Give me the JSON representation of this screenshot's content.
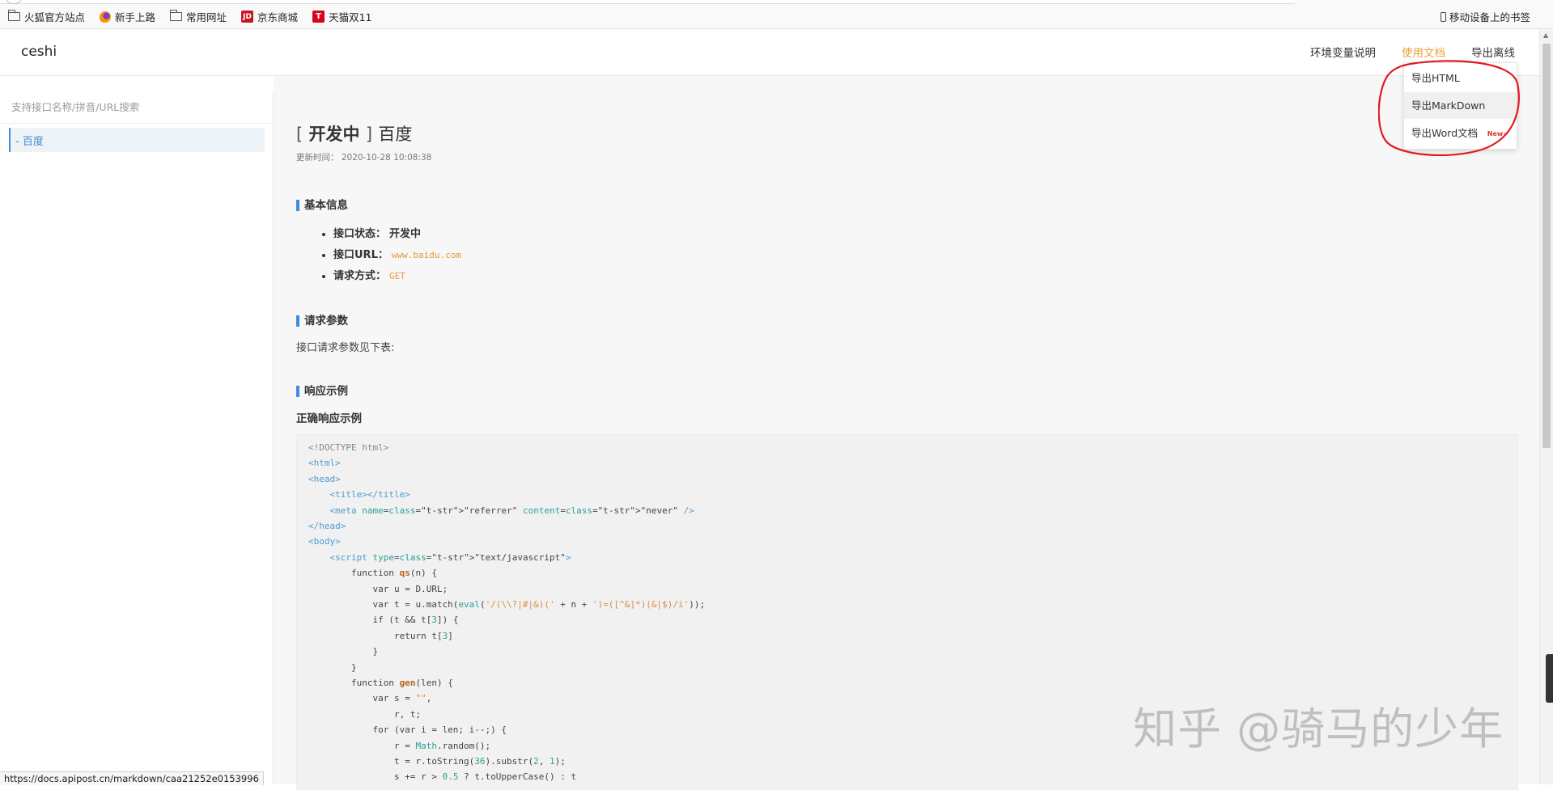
{
  "bookmarks": {
    "items": [
      {
        "label": "火狐官方站点",
        "icon": "folder-icon"
      },
      {
        "label": "新手上路",
        "icon": "firefox-icon"
      },
      {
        "label": "常用网址",
        "icon": "folder-icon"
      },
      {
        "label": "京东商城",
        "icon": "jd-icon",
        "icon_text": "JD"
      },
      {
        "label": "天猫双11",
        "icon": "tmall-icon",
        "icon_text": "T"
      }
    ],
    "mobile": "移动设备上的书签"
  },
  "header": {
    "logo": "ceshi",
    "nav": [
      "环境变量说明",
      "使用文档",
      "导出离线"
    ],
    "active_color": "#e8a33d"
  },
  "sidebar": {
    "search_placeholder": "支持接口名称/拼音/URL搜索",
    "items": [
      {
        "label": "- 百度"
      }
    ],
    "accent": "#3f8cd8"
  },
  "doc": {
    "status_bracket_open": "[",
    "status_word": "开发中",
    "status_bracket_close": "]",
    "name": "百度",
    "update_time": "更新时间：  2020-10-28 10:08:38",
    "sections": {
      "basic": "基本信息",
      "params": "请求参数",
      "response": "响应示例"
    },
    "info": [
      {
        "key": "接口状态：",
        "value": "开发中"
      },
      {
        "key": "接口URL：",
        "value": "www.baidu.com"
      },
      {
        "key": "请求方式：",
        "value": "GET"
      }
    ],
    "params_text": "接口请求参数见下表:",
    "response_sub": "正确响应示例"
  },
  "code_lines": [
    "<!DOCTYPE html>",
    "<html>",
    "<head>",
    "    <title></title>",
    "    <meta name=\"referrer\" content=\"never\" />",
    "</head>",
    "<body>",
    "    <script type=\"text/javascript\">",
    "        function qs(n) {",
    "            var u = D.URL;",
    "            var t = u.match(eval('/(\\\\?|#|&)(' + n + ')=([^&]*)(&|$)/i'));",
    "            if (t && t[3]) {",
    "                return t[3]",
    "            }",
    "        }",
    "        function gen(len) {",
    "            var s = \"\",",
    "                r, t;",
    "            for (var i = len; i--;) {",
    "                r = Math.random();",
    "                t = r.toString(36).substr(2, 1);",
    "                s += r > 0.5 ? t.toUpperCase() : t"
  ],
  "dropdown": {
    "items": [
      "导出HTML",
      "导出MarkDown",
      "导出Word文档"
    ],
    "new_badge": "New~"
  },
  "status_url": "https://docs.apipost.cn/markdown/caa21252e0153996",
  "watermark": "知乎 @骑马的少年"
}
